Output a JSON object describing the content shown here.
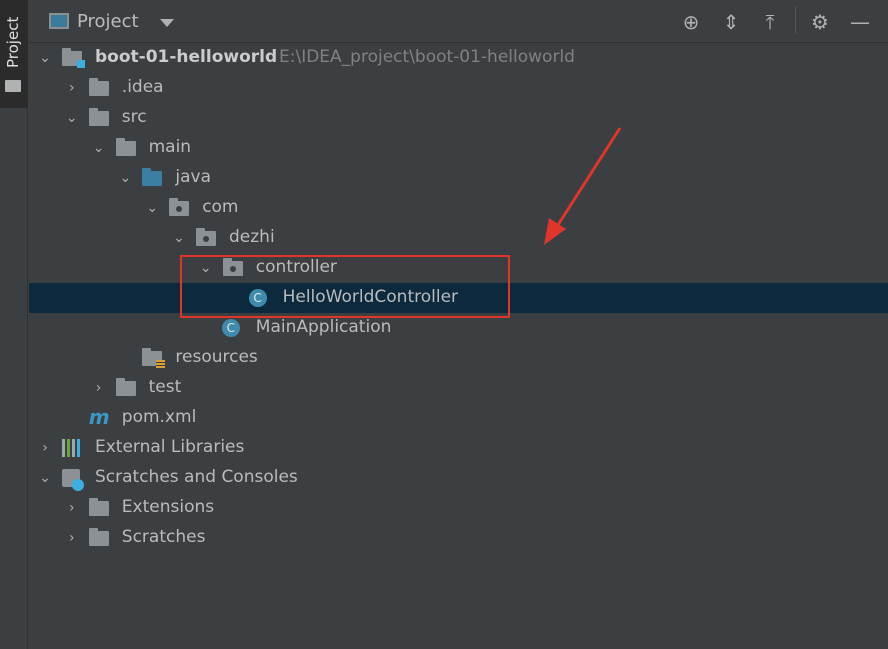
{
  "side_tab": {
    "label": "Project"
  },
  "header": {
    "title": "Project",
    "icons": [
      "locate-icon",
      "expand-all-icon",
      "collapse-all-icon",
      "gear-icon",
      "minimize-icon"
    ]
  },
  "tree": [
    {
      "label": "boot-01-helloworld",
      "path": "E:\\IDEA_project\\boot-01-helloworld",
      "level": 0,
      "state": "open",
      "icon": "module-folder"
    },
    {
      "label": ".idea",
      "level": 1,
      "state": "closed",
      "icon": "folder"
    },
    {
      "label": "src",
      "level": 1,
      "state": "open",
      "icon": "folder"
    },
    {
      "label": "main",
      "level": 2,
      "state": "open",
      "icon": "folder"
    },
    {
      "label": "java",
      "level": 3,
      "state": "open",
      "icon": "source-folder"
    },
    {
      "label": "com",
      "level": 4,
      "state": "open",
      "icon": "package"
    },
    {
      "label": "dezhi",
      "level": 5,
      "state": "open",
      "icon": "package"
    },
    {
      "label": "controller",
      "level": 6,
      "state": "open",
      "icon": "package"
    },
    {
      "label": "HelloWorldController",
      "level": 7,
      "state": "leaf",
      "icon": "class",
      "selected": true
    },
    {
      "label": "MainApplication",
      "level": 6,
      "state": "leaf",
      "icon": "spring-boot-class"
    },
    {
      "label": "resources",
      "level": 3,
      "state": "leaf",
      "icon": "resources-folder"
    },
    {
      "label": "test",
      "level": 2,
      "state": "closed",
      "icon": "folder"
    },
    {
      "label": "pom.xml",
      "level": 1,
      "state": "leaf",
      "icon": "maven"
    },
    {
      "label": "External Libraries",
      "level": 0,
      "state": "closed",
      "icon": "libraries"
    },
    {
      "label": "Scratches and Consoles",
      "level": 0,
      "state": "open",
      "icon": "scratches"
    },
    {
      "label": "Extensions",
      "level": 1,
      "state": "closed",
      "icon": "folder"
    },
    {
      "label": "Scratches",
      "level": 1,
      "state": "closed",
      "icon": "folder"
    }
  ],
  "colors": {
    "selection": "#0d293e",
    "annotation": "#e0352b",
    "background": "#3c3f41"
  }
}
